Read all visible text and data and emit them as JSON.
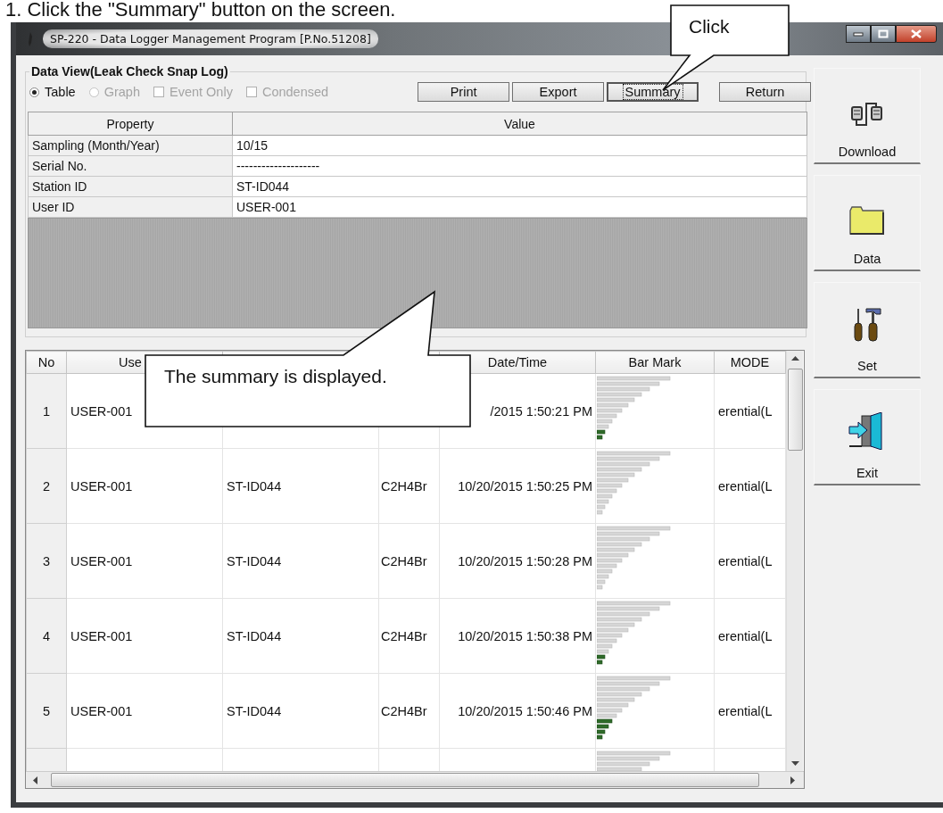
{
  "heading": "1.  Click the \"Summary\" button on the screen.",
  "window": {
    "title": "SP-220  - Data Logger Management Program [P.No.51208]"
  },
  "data_view": {
    "title": "Data View(Leak Check Snap Log)",
    "options": [
      {
        "kind": "radio",
        "label": "Table",
        "selected": true,
        "disabled": false
      },
      {
        "kind": "radio",
        "label": "Graph",
        "selected": false,
        "disabled": true
      },
      {
        "kind": "checkbox",
        "label": "Event Only",
        "checked": false,
        "disabled": true
      },
      {
        "kind": "checkbox",
        "label": "Condensed",
        "checked": false,
        "disabled": true
      }
    ],
    "buttons": [
      {
        "label": "Print",
        "focused": false
      },
      {
        "label": "Export",
        "focused": false
      },
      {
        "label": "Summary",
        "focused": true
      },
      {
        "label": "Return",
        "focused": false
      }
    ]
  },
  "properties": {
    "columns": [
      "Property",
      "Value"
    ],
    "rows": [
      {
        "property": "Sampling (Month/Year)",
        "value": "10/15"
      },
      {
        "property": "Serial No.",
        "value": "--------------------"
      },
      {
        "property": "Station ID",
        "value": "ST-ID044"
      },
      {
        "property": "User ID",
        "value": "USER-001"
      }
    ]
  },
  "log_table": {
    "columns": [
      "No",
      "Use",
      null,
      null,
      "Date/Time",
      "Bar Mark",
      "MODE"
    ],
    "rows": [
      {
        "no": "1",
        "user_id": "USER-001",
        "date_time": "/2015 1:50:21 PM",
        "mode": "erential(L",
        "bars_on": [
          false,
          false,
          false,
          false,
          false,
          false,
          false,
          false,
          false,
          false,
          true,
          true
        ]
      },
      {
        "no": "2",
        "user_id": "USER-001",
        "station_id": "ST-ID044",
        "column_4": "C2H4Br",
        "date_time": "10/20/2015 1:50:25 PM",
        "mode": "erential(L",
        "bars_on": [
          false,
          false,
          false,
          false,
          false,
          false,
          false,
          false,
          false,
          false,
          false,
          false
        ]
      },
      {
        "no": "3",
        "user_id": "USER-001",
        "station_id": "ST-ID044",
        "column_4": "C2H4Br",
        "date_time": "10/20/2015 1:50:28 PM",
        "mode": "erential(L",
        "bars_on": [
          false,
          false,
          false,
          false,
          false,
          false,
          false,
          false,
          false,
          false,
          false,
          false
        ]
      },
      {
        "no": "4",
        "user_id": "USER-001",
        "station_id": "ST-ID044",
        "column_4": "C2H4Br",
        "date_time": "10/20/2015 1:50:38 PM",
        "mode": "erential(L",
        "bars_on": [
          false,
          false,
          false,
          false,
          false,
          false,
          false,
          false,
          false,
          false,
          true,
          true
        ]
      },
      {
        "no": "5",
        "user_id": "USER-001",
        "station_id": "ST-ID044",
        "column_4": "C2H4Br",
        "date_time": "10/20/2015 1:50:46 PM",
        "mode": "erential(L",
        "bars_on": [
          false,
          false,
          false,
          false,
          false,
          false,
          false,
          false,
          true,
          true,
          true,
          true
        ]
      },
      {
        "bars_on": [
          false,
          false,
          false,
          false
        ]
      }
    ]
  },
  "sidebar": {
    "buttons": [
      {
        "label": "Download"
      },
      {
        "label": "Data"
      },
      {
        "label": "Set"
      },
      {
        "label": "Exit"
      }
    ]
  },
  "callouts": [
    {
      "text": "Click"
    },
    {
      "text": "The summary is displayed."
    }
  ]
}
